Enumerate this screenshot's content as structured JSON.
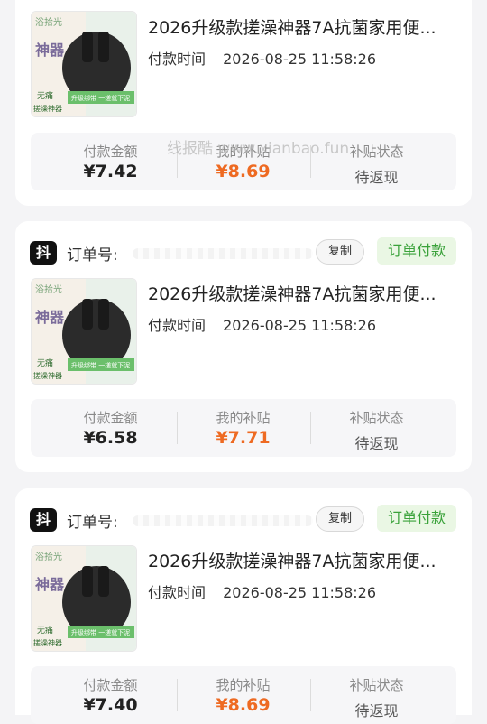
{
  "orders": [
    {
      "platform_badge": "",
      "order_label": "",
      "copy_label": "",
      "status": "",
      "product_title": "2026升级款搓澡神器7A抗菌家用便...",
      "pay_time_label": "付款时间",
      "pay_time": "2026-08-25 11:58:26",
      "stats": {
        "amount_label": "付款金额",
        "amount": "¥7.42",
        "subsidy_label": "我的补贴",
        "subsidy": "¥8.69",
        "state_label": "补贴状态",
        "state": "待返现"
      }
    },
    {
      "platform_badge": "抖",
      "order_label": "订单号:",
      "copy_label": "复制",
      "status": "订单付款",
      "product_title": "2026升级款搓澡神器7A抗菌家用便...",
      "pay_time_label": "付款时间",
      "pay_time": "2026-08-25 11:58:26",
      "stats": {
        "amount_label": "付款金额",
        "amount": "¥6.58",
        "subsidy_label": "我的补贴",
        "subsidy": "¥7.71",
        "state_label": "补贴状态",
        "state": "待返现"
      }
    },
    {
      "platform_badge": "抖",
      "order_label": "订单号:",
      "copy_label": "复制",
      "status": "订单付款",
      "product_title": "2026升级款搓澡神器7A抗菌家用便...",
      "pay_time_label": "付款时间",
      "pay_time": "2026-08-25 11:58:26",
      "stats": {
        "amount_label": "付款金额",
        "amount": "¥7.40",
        "subsidy_label": "我的补贴",
        "subsidy": "¥8.69",
        "state_label": "补贴状态",
        "state": "待返现"
      }
    }
  ],
  "thumbnail": {
    "brand": "浴拾光",
    "product_word": "神器",
    "tag1": "无痛",
    "tag2": "搓澡神器",
    "tag3": "升级绑带 一搓就下泥"
  },
  "watermark": "线报酷 www.xianbao.fun",
  "colors": {
    "accent_orange": "#ee6a22",
    "status_green": "#3aa23a"
  }
}
